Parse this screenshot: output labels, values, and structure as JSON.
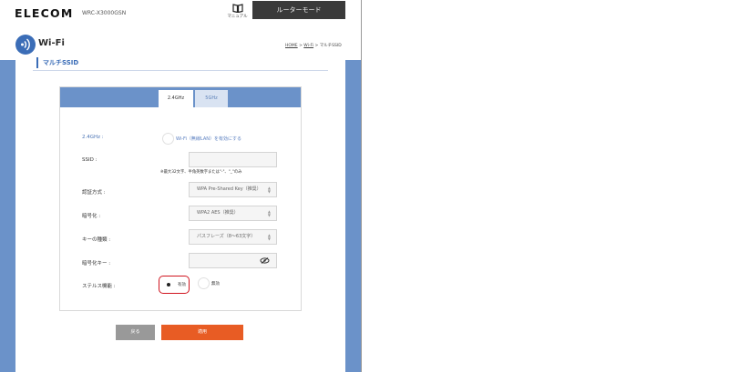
{
  "header": {
    "brand": "ELECOM",
    "model": "WRC-X3000GSN",
    "manual_label": "マニュアル",
    "mode_button": "ルーターモード"
  },
  "page": {
    "title": "Wi-Fi",
    "breadcrumb": {
      "home": "HOME",
      "sep1": " > ",
      "wifi": "Wi-Fi",
      "sep2": " > ",
      "current": "マルチSSID"
    },
    "section_title": "マルチSSID"
  },
  "tabs": [
    {
      "label": "2.4GHz",
      "active": true
    },
    {
      "label": "5GHz",
      "active": false
    }
  ],
  "form": {
    "band_label": "2.4GHz :",
    "enable_text": "Wi-Fi（無線LAN）を有効にする",
    "ssid_label": "SSID :",
    "ssid_value": "",
    "ssid_hint": "※最大32文字、半角英数字または\"-\"、\"_\"のみ",
    "auth_label": "認証方式 :",
    "auth_value": "WPA Pre-Shared Key（推奨）",
    "enc_label": "暗号化 :",
    "enc_value": "WPA2 AES（推奨）",
    "keytype_label": "キーの種類 :",
    "keytype_value": "パスフレーズ（8～63文字）",
    "key_label": "暗号化キー :",
    "key_value": "",
    "stealth_label": "ステルス機能 :",
    "stealth_on": "有効",
    "stealth_off": "無効",
    "stealth_selected": "有効"
  },
  "buttons": {
    "back": "戻る",
    "apply": "適用"
  },
  "colors": {
    "accent_blue": "#6b92c9",
    "title_blue": "#3b6db7",
    "apply_orange": "#e85c24",
    "highlight_red": "#d0141f"
  }
}
